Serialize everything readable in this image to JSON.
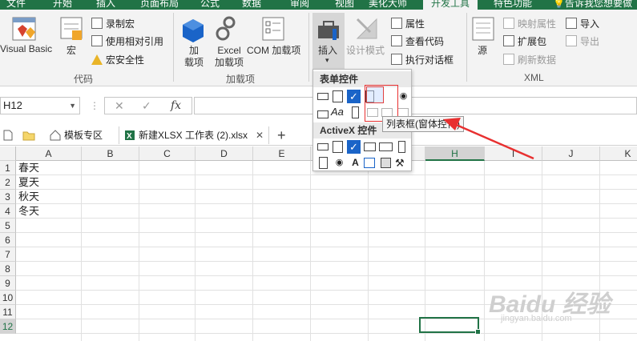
{
  "ribbon_tabs": [
    "文件",
    "开始",
    "插入",
    "页面布局",
    "公式",
    "数据",
    "审阅",
    "视图",
    "美化大师",
    "开发工具",
    "特色功能"
  ],
  "active_tab": "开发工具",
  "tell_me": "告诉我您想要做",
  "ribbon": {
    "code_group": {
      "label": "代码",
      "visual_basic": "Visual Basic",
      "macros": "宏",
      "record_macro": "录制宏",
      "relative_ref": "使用相对引用",
      "macro_security": "宏安全性"
    },
    "addins_group": {
      "label": "加载项",
      "addins": "加\n载项",
      "excel_addins": "Excel\n加载项",
      "com_addins": "COM 加载项"
    },
    "controls_group": {
      "insert": "插入",
      "design_mode": "设计模式",
      "properties": "属性",
      "view_code": "查看代码",
      "run_dialog": "执行对话框"
    },
    "xml_group": {
      "label": "XML",
      "source": "源",
      "map_properties": "映射属性",
      "expansion_packs": "扩展包",
      "refresh_data": "刷新数据",
      "import": "导入",
      "export": "导出"
    }
  },
  "dropdown": {
    "form_controls": "表单控件",
    "activex_controls": "ActiveX 控件",
    "tooltip": "列表框(窗体控件)"
  },
  "formula_bar": {
    "name_box": "H12",
    "fx": "fx",
    "formula": ""
  },
  "doc_tabs": {
    "template": "模板专区",
    "workbook": "新建XLSX 工作表 (2).xlsx",
    "add": "+"
  },
  "columns": [
    "A",
    "B",
    "C",
    "D",
    "E",
    "F",
    "G",
    "H",
    "I",
    "J",
    "K"
  ],
  "rows": [
    "1",
    "2",
    "3",
    "4",
    "5",
    "6",
    "7",
    "8",
    "9",
    "10",
    "11",
    "12"
  ],
  "cells": {
    "A1": "春天",
    "A2": "夏天",
    "A3": "秋天",
    "A4": "冬天"
  },
  "selected_cell": "H12",
  "watermark": {
    "brand": "Baidu 经验",
    "url": "jingyan.baidu.com"
  },
  "colors": {
    "excel_green": "#217346",
    "annotation_red": "#e83030"
  }
}
